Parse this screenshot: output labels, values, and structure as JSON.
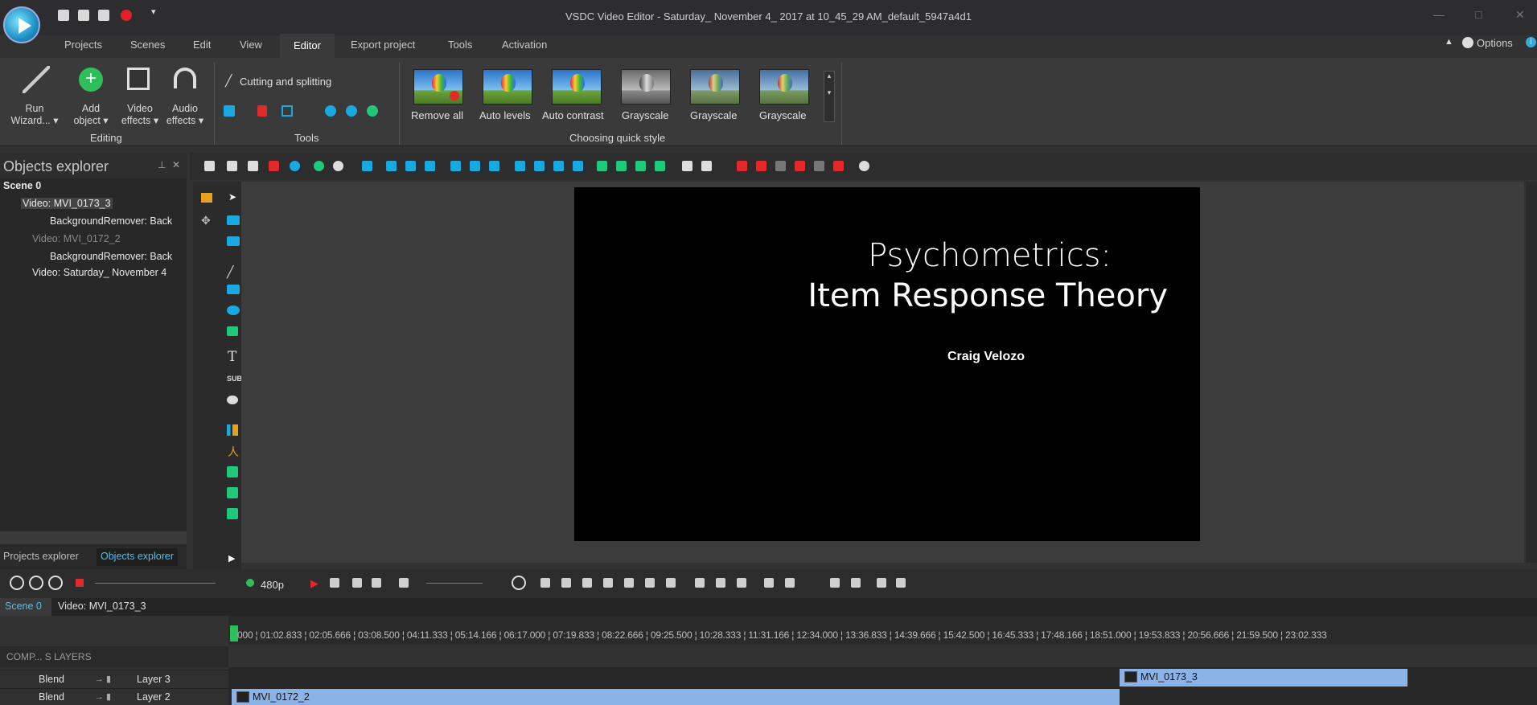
{
  "window": {
    "title": "VSDC Video Editor - Saturday_ November 4_ 2017 at 10_45_29 AM_default_5947a4d1"
  },
  "menu": [
    "Projects",
    "Scenes",
    "Edit",
    "View",
    "Editor",
    "Export project",
    "Tools",
    "Activation"
  ],
  "options_label": "Options",
  "ribbon": {
    "run_wizard": [
      "Run",
      "Wizard... ▾"
    ],
    "add_object": [
      "Add",
      "object ▾"
    ],
    "video_effects": [
      "Video",
      "effects ▾"
    ],
    "audio_effects": [
      "Audio",
      "effects ▾"
    ],
    "editing_group": "Editing",
    "cutting": "Cutting and splitting",
    "tools_group": "Tools",
    "quick_styles": [
      "Remove all",
      "Auto levels",
      "Auto contrast",
      "Grayscale",
      "Grayscale",
      "Grayscale"
    ],
    "quick_style_group": "Choosing quick style"
  },
  "objects_explorer": {
    "title": "Objects explorer",
    "tree": [
      "Scene 0",
      "Video: MVI_0173_3",
      "BackgroundRemover: Back",
      "Video: MVI_0172_2",
      "BackgroundRemover: Back",
      "Video: Saturday_ November 4"
    ],
    "tabs": [
      "Projects explorer",
      "Objects explorer"
    ]
  },
  "preview": {
    "title_line1": "Psychometrics:",
    "title_line2": "Item Response Theory",
    "author": "Craig Velozo"
  },
  "playbar": {
    "resolution": "480p"
  },
  "timeline": {
    "tabs": [
      "Scene 0",
      "Video: MVI_0173_3"
    ],
    "ruler": "000 ¦ 01:02.833 ¦ 02:05.666 ¦ 03:08.500 ¦ 04:11.333 ¦ 05:14.166 ¦ 06:17.000 ¦ 07:19.833 ¦ 08:22.666 ¦ 09:25.500 ¦ 10:28.333 ¦ 11:31.166 ¦ 12:34.000 ¦ 13:36.833 ¦ 14:39.666 ¦ 15:42.500 ¦ 16:45.333 ¦ 17:48.166 ¦ 18:51.000 ¦ 19:53.833 ¦ 20:56.666 ¦ 21:59.500 ¦ 23:02.333",
    "layer_header": "COMP... S  LAYERS",
    "layers": [
      {
        "blend": "Blend",
        "name": "Layer 3"
      },
      {
        "blend": "Blend",
        "name": "Layer 2"
      }
    ],
    "clips": [
      "MVI_0173_3",
      "MVI_0172_2"
    ]
  }
}
